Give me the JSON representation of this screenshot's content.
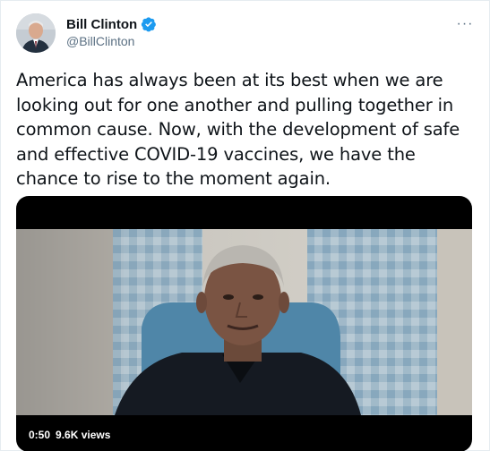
{
  "author": {
    "display_name": "Bill Clinton",
    "handle": "@BillClinton",
    "verified_icon": "verified-badge-icon",
    "avatar_icon": "profile-avatar"
  },
  "menu": {
    "icon": "more-options-icon",
    "glyph": "···"
  },
  "tweet": {
    "text": "America has always been at its best when we are looking out for one another and pulling together in common cause. Now, with the development of safe and effective COVID-19 vaccines, we have the chance to rise to the moment again."
  },
  "video": {
    "duration": "0:50",
    "views": "9.6K views"
  },
  "colors": {
    "accent": "#1d9bf0",
    "secondary_text": "#5b7083",
    "primary_text": "#0f1419"
  }
}
